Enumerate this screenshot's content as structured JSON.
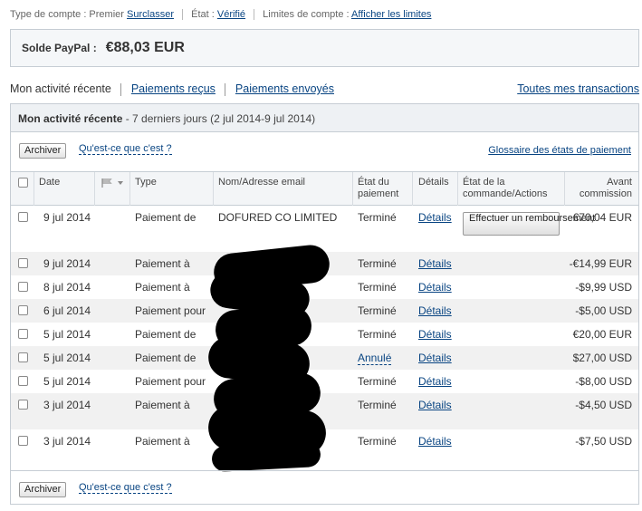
{
  "account": {
    "type_label": "Type de compte : Premier",
    "upgrade_link": "Surclasser",
    "status_label": "État :",
    "status_link": "Vérifié",
    "limits_label": "Limites de compte :",
    "limits_link": "Afficher les limites"
  },
  "balance": {
    "label": "Solde PayPal :",
    "value": "€88,03 EUR"
  },
  "tabs": {
    "recent": "Mon activité récente",
    "received": "Paiements reçus",
    "sent": "Paiements envoyés",
    "all": "Toutes mes transactions"
  },
  "panel": {
    "title": "Mon activité récente",
    "subtitle": "- 7 derniers jours (2 jul 2014-9 jul 2014)",
    "archive_label": "Archiver",
    "whats_this": "Qu'est-ce que c'est ?",
    "glossary": "Glossaire des états de paiement",
    "refund_label": "Effectuer un remboursement"
  },
  "columns": {
    "date": "Date",
    "type": "Type",
    "name": "Nom/Adresse email",
    "status": "État du paiement",
    "details": "Détails",
    "order": "État de la commande/Actions",
    "amount": "Avant commission"
  },
  "rows": [
    {
      "date": "9 jul 2014",
      "type": "Paiement de",
      "name": "DOFURED CO LIMITED",
      "status": "Terminé",
      "details": "Détails",
      "amount": "€70,04 EUR"
    },
    {
      "date": "9 jul 2014",
      "type": "Paiement à",
      "name": "",
      "status": "Terminé",
      "details": "Détails",
      "amount": "-€14,99 EUR"
    },
    {
      "date": "8 jul 2014",
      "type": "Paiement à",
      "name": "",
      "status": "Terminé",
      "details": "Détails",
      "amount": "-$9,99 USD"
    },
    {
      "date": "6 jul 2014",
      "type": "Paiement pour",
      "name": "",
      "status": "Terminé",
      "details": "Détails",
      "amount": "-$5,00 USD"
    },
    {
      "date": "5 jul 2014",
      "type": "Paiement de",
      "name": "",
      "status": "Terminé",
      "details": "Détails",
      "amount": "€20,00 EUR"
    },
    {
      "date": "5 jul 2014",
      "type": "Paiement de",
      "name": "",
      "status": "Annulé",
      "details": "Détails",
      "amount": "$27,00 USD"
    },
    {
      "date": "5 jul 2014",
      "type": "Paiement pour",
      "name": "",
      "status": "Terminé",
      "details": "Détails",
      "amount": "-$8,00 USD"
    },
    {
      "date": "3 jul 2014",
      "type": "Paiement à",
      "name": "",
      "status": "Terminé",
      "details": "Détails",
      "amount": "-$4,50 USD"
    },
    {
      "date": "3 jul 2014",
      "type": "Paiement à",
      "name": "",
      "status": "Terminé",
      "details": "Détails",
      "amount": "-$7,50 USD"
    }
  ]
}
